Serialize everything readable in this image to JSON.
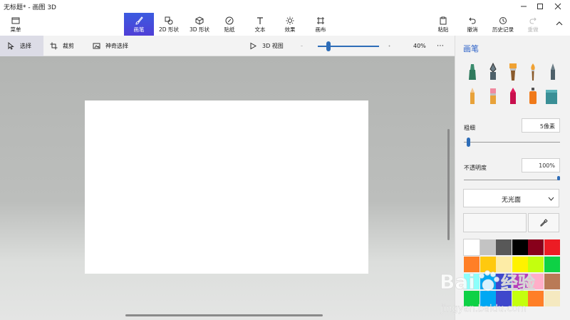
{
  "window": {
    "title": "无标题* - 画图 3D"
  },
  "toolbar": {
    "menu": "菜单",
    "tools": [
      {
        "label": "画笔",
        "icon": "brush-icon",
        "active": true
      },
      {
        "label": "2D 形状",
        "icon": "2d-shapes-icon"
      },
      {
        "label": "3D 形状",
        "icon": "3d-shapes-icon"
      },
      {
        "label": "贴纸",
        "icon": "stickers-icon"
      },
      {
        "label": "文本",
        "icon": "text-icon"
      },
      {
        "label": "效果",
        "icon": "effects-icon"
      },
      {
        "label": "画布",
        "icon": "canvas-icon"
      }
    ],
    "paste": "粘贴",
    "undo": "撤消",
    "history": "历史记录",
    "redo": "重做"
  },
  "subbar": {
    "select": "选择",
    "crop": "裁剪",
    "magic_select": "神奇选择",
    "view_3d": "3D 视图",
    "zoom_level": "40%",
    "zoom_fraction": 0.2,
    "more": "⋯"
  },
  "panel": {
    "title": "画笔",
    "brushes_row1": [
      "marker",
      "calligraphy-pen",
      "oil-brush",
      "watercolor",
      "pixel-pen"
    ],
    "brushes_row2": [
      "pencil",
      "eraser",
      "crayon",
      "spraycan",
      "fill"
    ],
    "thickness_label": "粗细",
    "thickness_value": "5像素",
    "thickness_fraction": 0.04,
    "opacity_label": "不透明度",
    "opacity_value": "100%",
    "opacity_fraction": 1.0,
    "finish": "无光面",
    "palette": [
      "#ffffff",
      "#c3c3c3",
      "#585858",
      "#000000",
      "#88001b",
      "#ec1c24",
      "#ff7f27",
      "#ffc90e",
      "#fdeca6",
      "#fff200",
      "#c4ff0e",
      "#0ed145",
      "#8cfffb",
      "#00a8f3",
      "#3f48cc",
      "#b83dba",
      "#ffaec8",
      "#b97a56",
      "#0ed145",
      "#00a8f3",
      "#3f48cc",
      "#c4ff0e",
      "#ff7f27",
      "#f5e9c0"
    ]
  },
  "watermark": {
    "brand_left": "Bai",
    "brand_right": "经验",
    "url": "jingyan.baidu.com"
  }
}
